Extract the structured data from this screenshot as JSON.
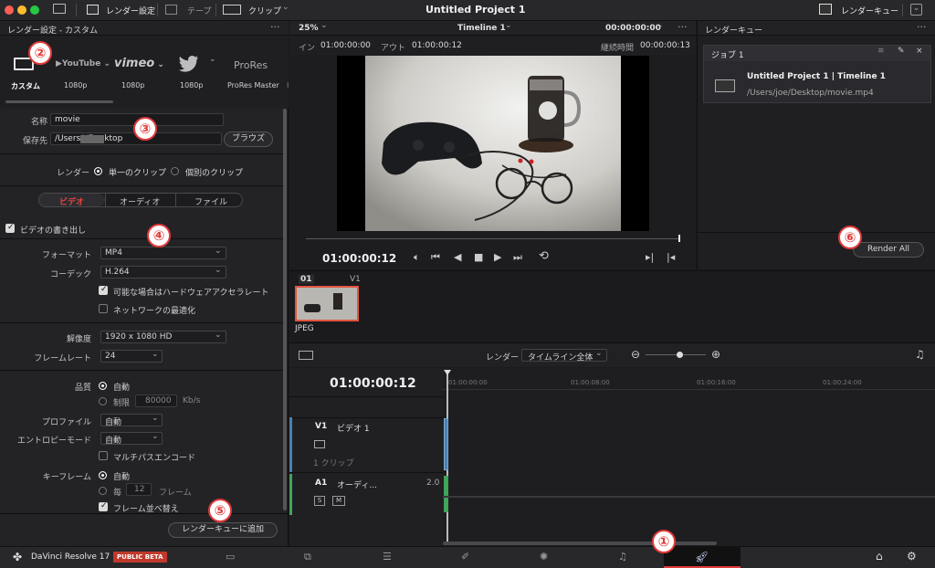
{
  "topbar": {
    "render_settings": "レンダー設定",
    "tape": "テープ",
    "clip": "クリップ",
    "project_title": "Untitled Project 1",
    "render_queue": "レンダーキュー"
  },
  "left": {
    "header": "レンダー設定 - カスタム",
    "presets": [
      {
        "label": "カスタム"
      },
      {
        "brand": "YouTube",
        "label": "1080p"
      },
      {
        "brand": "vimeo",
        "label": "1080p"
      },
      {
        "label": "1080p"
      },
      {
        "brand": "ProRes",
        "label": "ProRes Master"
      }
    ],
    "name_label": "名称",
    "name_value": "movie",
    "location_label": "保存先",
    "location_value": "/Users/    /Desktop",
    "browse": "ブラウズ",
    "render_label": "レンダー",
    "single_clip": "単一のクリップ",
    "individual_clips": "個別のクリップ",
    "tabs": [
      "ビデオ",
      "オーディオ",
      "ファイル"
    ],
    "export_video": "ビデオの書き出し",
    "format_label": "フォーマット",
    "format_value": "MP4",
    "codec_label": "コーデック",
    "codec_value": "H.264",
    "hw_accel": "可能な場合はハードウェアアクセラレート",
    "net_opt": "ネットワークの最適化",
    "resolution_label": "解像度",
    "resolution_value": "1920 x 1080 HD",
    "framerate_label": "フレームレート",
    "framerate_value": "24",
    "quality_label": "品質",
    "auto": "自動",
    "limit": "制限",
    "limit_value": "80000",
    "kbs": "Kb/s",
    "profile_label": "プロファイル",
    "profile_value": "自動",
    "entropy_label": "エントロピーモード",
    "entropy_value": "自動",
    "multipass": "マルチパスエンコード",
    "keyframe_label": "キーフレーム",
    "every": "毎",
    "every_value": "12",
    "frames": "フレーム",
    "frame_reorder": "フレーム並べ替え",
    "add_to_queue": "レンダーキューに追加"
  },
  "viewer": {
    "zoom": "25%",
    "timeline_name": "Timeline 1",
    "tc_top": "00:00:00:00",
    "in_label": "イン",
    "in_value": "01:00:00:00",
    "out_label": "アウト",
    "out_value": "01:00:00:12",
    "duration_label": "継続時間",
    "duration_value": "00:00:00:13",
    "current_tc": "01:00:00:12"
  },
  "clips": {
    "index": "01",
    "track": "V1",
    "type": "JPEG"
  },
  "timeline": {
    "render_label": "レンダー",
    "render_range": "タイムライン全体",
    "timecode": "01:00:00:12",
    "ruler": [
      "01:00:00:00",
      "01:00:08:00",
      "01:00:16:00",
      "01:00:24:00"
    ],
    "v1": "V1",
    "v1_name": "ビデオ 1",
    "v1_clips": "1 クリップ",
    "a1": "A1",
    "a1_name": "オーディ...",
    "a1_ch": "2.0",
    "s": "S",
    "m": "M"
  },
  "queue": {
    "header": "レンダーキュー",
    "job_title": "ジョブ 1",
    "job_name": "Untitled Project 1 | Timeline 1",
    "job_path": "/Users/joe/Desktop/movie.mp4",
    "render_all": "Render All"
  },
  "bottom": {
    "app": "DaVinci Resolve 17",
    "beta": "PUBLIC BETA"
  },
  "annotations": [
    "①",
    "②",
    "③",
    "④",
    "⑤",
    "⑥"
  ],
  "colors": {
    "accent_red": "#e03a3a",
    "tab_active": "#e8433a",
    "video_track": "#4a7fb0",
    "audio_track": "#3fa55a"
  }
}
